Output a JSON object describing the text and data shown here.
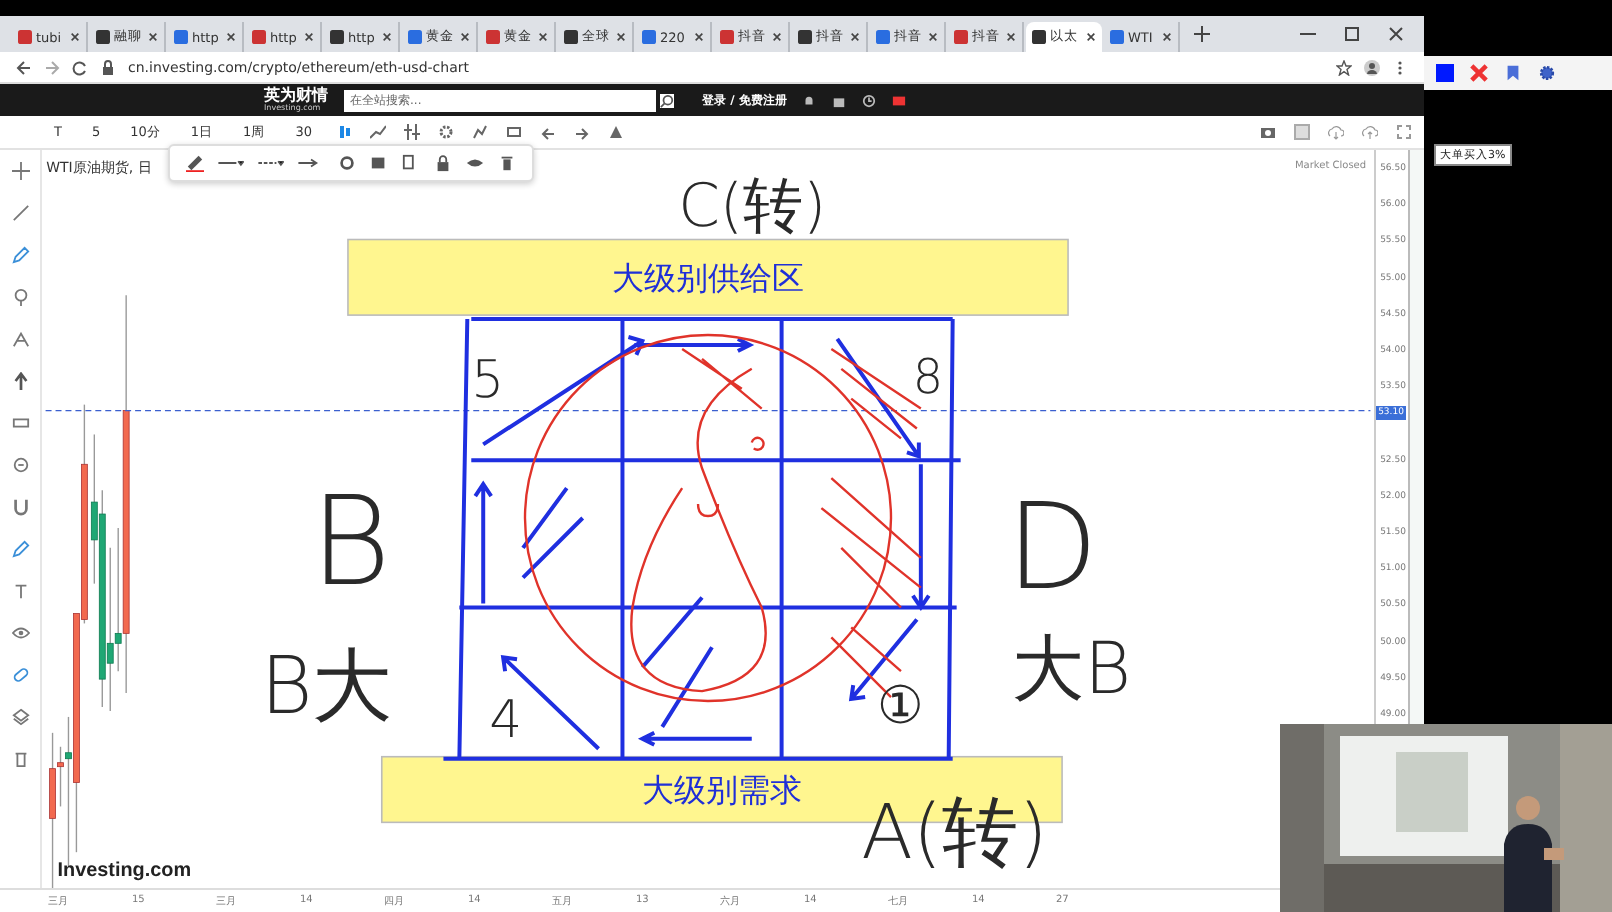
{
  "browser": {
    "tabs": [
      {
        "label": "tubi",
        "selected": false
      },
      {
        "label": "融聊",
        "selected": false
      },
      {
        "label": "http",
        "selected": false
      },
      {
        "label": "http",
        "selected": false
      },
      {
        "label": "http",
        "selected": false
      },
      {
        "label": "黄金",
        "selected": false
      },
      {
        "label": "黄金",
        "selected": false
      },
      {
        "label": "全球",
        "selected": false
      },
      {
        "label": "220",
        "selected": false
      },
      {
        "label": "抖音",
        "selected": false
      },
      {
        "label": "抖音",
        "selected": false
      },
      {
        "label": "抖音",
        "selected": false
      },
      {
        "label": "抖音",
        "selected": false
      },
      {
        "label": "以太",
        "selected": true
      },
      {
        "label": "WTI",
        "selected": false
      }
    ],
    "url": "cn.investing.com/crypto/ethereum/eth-usd-chart"
  },
  "site_header": {
    "logo": "英为财情",
    "logo_sub": "Investing.com",
    "search": {
      "placeholder": "在全站搜索..."
    },
    "login": "登录 / 免费注册"
  },
  "chart_toolbar": {
    "buttons": [
      "T",
      "5",
      "10分",
      "1日",
      "1周",
      "30"
    ]
  },
  "chart": {
    "title": "WTI原油期货, 日",
    "status": "Market Closed",
    "watermark": "Investing.com",
    "price_ticks": [
      "56.50",
      "56.00",
      "55.50",
      "55.00",
      "54.50",
      "54.00",
      "53.50",
      "52.50",
      "52.00",
      "51.50",
      "51.00",
      "50.50",
      "50.00",
      "49.50",
      "49.00"
    ],
    "current_price": "53.10",
    "date_labels": [
      "三月",
      "15",
      "三月",
      "14",
      "四月",
      "14",
      "五月",
      "13",
      "六月",
      "14",
      "七月",
      "14",
      "27"
    ],
    "zones": [
      {
        "kind": "supply",
        "label": "大级别供给区"
      },
      {
        "kind": "demand",
        "label": "大级别需求"
      }
    ],
    "handwriting": [
      {
        "text": "C(转)"
      },
      {
        "text": "B"
      },
      {
        "text": "B大"
      },
      {
        "text": "D"
      },
      {
        "text": "大B"
      },
      {
        "text": "A(转)"
      },
      {
        "text": "5"
      },
      {
        "text": "8"
      },
      {
        "text": "4"
      },
      {
        "text": "①"
      }
    ]
  },
  "overlay": {
    "tooltip": "大单买入3%"
  }
}
